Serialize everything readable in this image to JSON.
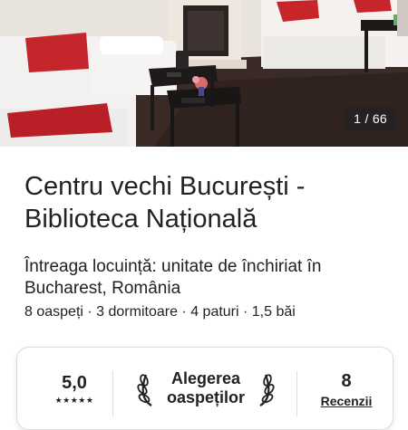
{
  "photo": {
    "counter": "1 / 66"
  },
  "listing": {
    "title_line1": "Centru vechi București -",
    "title_line2": "Biblioteca Națională",
    "subtitle_line1": "Întreaga locuință: unitate de închiriat în",
    "subtitle_line2": "Bucharest, România",
    "details": "8 oaspeți · 3 dormitoare · 4 paturi · 1,5 băi"
  },
  "stats": {
    "rating": "5,0",
    "stars": "★★★★★",
    "favorite_line1": "Alegerea",
    "favorite_line2": "oaspeților",
    "reviews_count": "8",
    "reviews_label": "Recenzii"
  }
}
